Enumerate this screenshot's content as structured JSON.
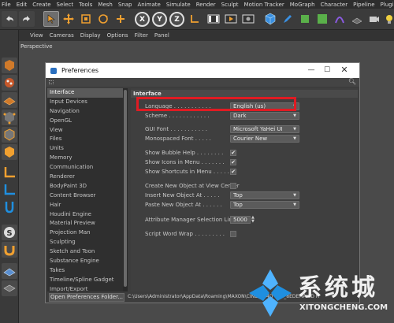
{
  "menubar": {
    "items": [
      "File",
      "Edit",
      "Create",
      "Select",
      "Tools",
      "Mesh",
      "Snap",
      "Animate",
      "Simulate",
      "Render",
      "Sculpt",
      "Motion Tracker",
      "MoGraph",
      "Character",
      "Pipeline",
      "Plugins"
    ]
  },
  "toolbar": {
    "axis_x": "X",
    "axis_y": "Y",
    "axis_z": "Z",
    "tools": [
      "undo-icon",
      "redo-icon",
      "select-icon",
      "move-icon",
      "scale-icon",
      "rotate-icon",
      "add-icon",
      "coordinate-icon",
      "render-view-icon",
      "render-icon",
      "render-settings-icon",
      "cube-icon",
      "pen-icon",
      "subdivision-icon",
      "array-icon",
      "deformer-icon",
      "floor-icon",
      "camera-icon",
      "light-icon"
    ]
  },
  "viewport": {
    "menu": [
      "View",
      "Cameras",
      "Display",
      "Options",
      "Filter",
      "Panel"
    ],
    "label": "Perspective"
  },
  "dialog": {
    "title": "Preferences",
    "tree_items": [
      "Interface",
      "Input Devices",
      "Navigation",
      "OpenGL",
      "View",
      "Files",
      "Units",
      "Memory",
      "Communication",
      "Renderer",
      "BodyPaint 3D",
      "Content Browser",
      "Hair",
      "Houdini Engine",
      "Material Preview",
      "Projection Man",
      "Sculpting",
      "Sketch and Toon",
      "Substance Engine",
      "Takes",
      "Timeline/Spline Gadget",
      "Import/Export"
    ],
    "selected_tree_item": "Interface",
    "panel_title": "Interface",
    "language_label": "Language",
    "language_value": "English (us)",
    "scheme_label": "Scheme",
    "scheme_value": "Dark",
    "gui_font_label": "GUI Font",
    "gui_font_value": "Microsoft YaHei UI",
    "mono_font_label": "Monospaced Font",
    "mono_font_value": "Courier New",
    "bubble_help_label": "Show Bubble Help",
    "bubble_help_checked": true,
    "icons_menu_label": "Show Icons in Menu",
    "icons_menu_checked": true,
    "shortcuts_menu_label": "Show Shortcuts in Menu",
    "shortcuts_menu_checked": true,
    "create_center_label": "Create New Object at View Center",
    "create_center_checked": false,
    "insert_new_label": "Insert New Object At",
    "insert_new_value": "Top",
    "paste_new_label": "Paste New Object At",
    "paste_new_value": "Top",
    "attr_limit_label": "Attribute Manager Selection Limit",
    "attr_limit_value": "5000",
    "script_wrap_label": "Script Word Wrap",
    "script_wrap_checked": false,
    "checkmark": "✔",
    "open_folder_button": "Open Preferences Folder...",
    "path_text": "C:\\Users\\Administrator\\AppData\\Roaming\\MAXON\\CINEMA 4D R18_8EDEMA 4D R"
  },
  "watermark": {
    "text": "系统城",
    "url": "XITONGCHENG.COM"
  },
  "colors": {
    "highlight": "#e01b23",
    "accent_orange": "#f0a030",
    "logo_blue": "#1f8fe0"
  }
}
